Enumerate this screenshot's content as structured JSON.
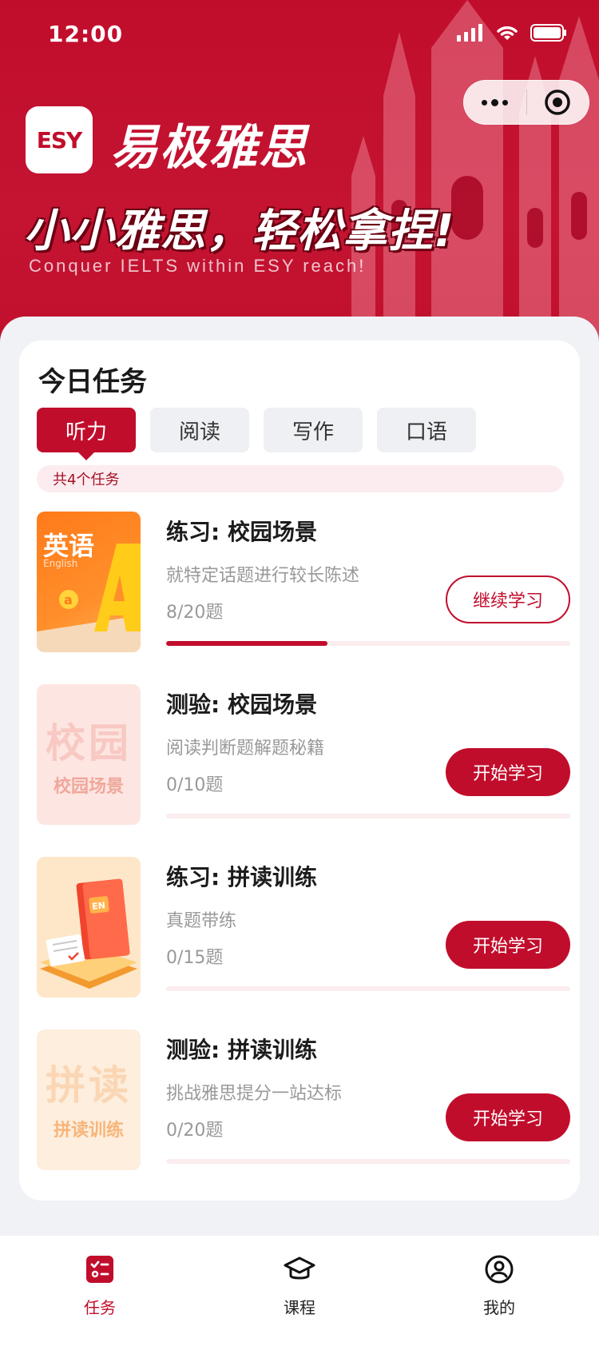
{
  "status_bar": {
    "time": "12:00"
  },
  "header": {
    "logo_text": "ESY",
    "brand": "易极雅思",
    "slogan": "小小雅思，轻松拿捏!",
    "slogan_en": "Conquer IELTS within ESY reach!"
  },
  "today": {
    "title": "今日任务",
    "tabs": [
      {
        "label": "听力",
        "active": true
      },
      {
        "label": "阅读",
        "active": false
      },
      {
        "label": "写作",
        "active": false
      },
      {
        "label": "口语",
        "active": false
      }
    ],
    "count_text": "共4个任务",
    "tasks": [
      {
        "title": "练习: 校园场景",
        "desc": "就特定话题进行较长陈述",
        "progress_text": "8/20题",
        "done": 8,
        "total": 20,
        "button": "继续学习",
        "button_style": "outline",
        "thumb": {
          "title": "英语",
          "subtitle": "English",
          "letters": "a A"
        }
      },
      {
        "title": "测验: 校园场景",
        "desc": "阅读判断题解题秘籍",
        "progress_text": "0/10题",
        "done": 0,
        "total": 10,
        "button": "开始学习",
        "button_style": "primary",
        "thumb": {
          "big": "校园",
          "small": "校园场景"
        }
      },
      {
        "title": "练习: 拼读训练",
        "desc": "真题带练",
        "progress_text": "0/15题",
        "done": 0,
        "total": 15,
        "button": "开始学习",
        "button_style": "primary",
        "thumb": {
          "book": "EN"
        }
      },
      {
        "title": "测验: 拼读训练",
        "desc": "挑战雅思提分一站达标",
        "progress_text": "0/20题",
        "done": 0,
        "total": 20,
        "button": "开始学习",
        "button_style": "primary",
        "thumb": {
          "big": "拼读",
          "small": "拼读训练"
        }
      }
    ]
  },
  "nav": [
    {
      "label": "任务",
      "icon": "task-list-icon",
      "active": true
    },
    {
      "label": "课程",
      "icon": "graduation-cap-icon",
      "active": false
    },
    {
      "label": "我的",
      "icon": "user-circle-icon",
      "active": false
    }
  ],
  "colors": {
    "primary": "#c10d2c",
    "background": "#f1f2f5"
  }
}
